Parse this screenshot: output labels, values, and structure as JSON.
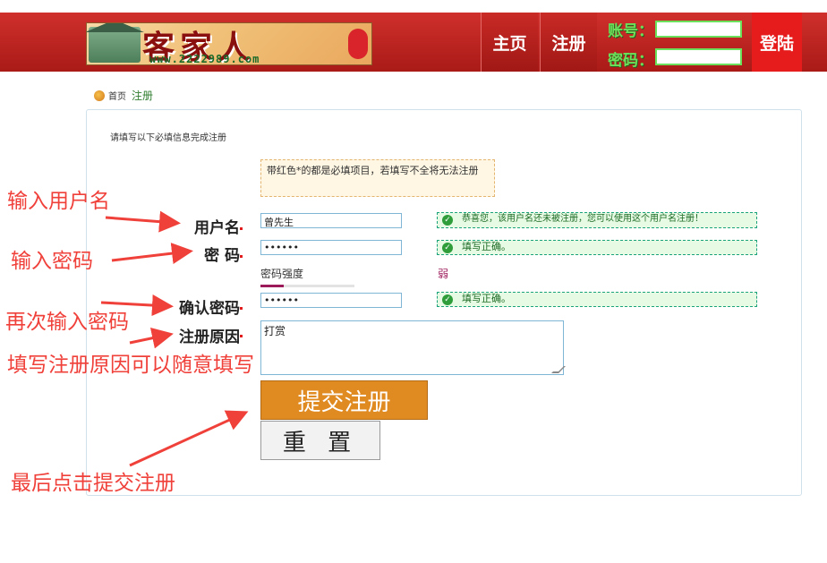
{
  "header": {
    "logo_title": "客家人",
    "logo_url": "www.2222989.com",
    "nav": [
      "主页",
      "注册"
    ],
    "login": {
      "user_label": "账号：",
      "pass_label": "密码：",
      "button": "登陆"
    }
  },
  "breadcrumb": {
    "home": "首页",
    "current": "注册"
  },
  "form": {
    "title": "请填写以下必填信息完成注册",
    "notice": "带红色*的都是必填项目，若填写不全将无法注册",
    "username_label": "用户名",
    "username_value": "曾先生",
    "username_hint": "恭喜您，该用户名还未被注册，您可以使用这个用户名注册！",
    "password_label": "密 码",
    "password_value": "••••••",
    "password_hint": "填写正确。",
    "strength_label": "密码强度",
    "strength_value": "弱",
    "strength_level": 0.25,
    "confirm_label": "确认密码",
    "confirm_value": "••••••",
    "confirm_hint": "填写正确。",
    "reason_label": "注册原因",
    "reason_value": "打赏",
    "submit_label": "提交注册",
    "reset_label": "重 置"
  },
  "annotations": {
    "username": "输入用户名",
    "password": "输入密码",
    "confirm": "再次输入密码",
    "reason": "填写注册原因可以随意填写",
    "submit": "最后点击提交注册"
  },
  "colors": {
    "header_red": "#c62a26",
    "login_green": "#6be05a",
    "submit_orange": "#e08a22",
    "annotation_red": "#f0403a"
  }
}
